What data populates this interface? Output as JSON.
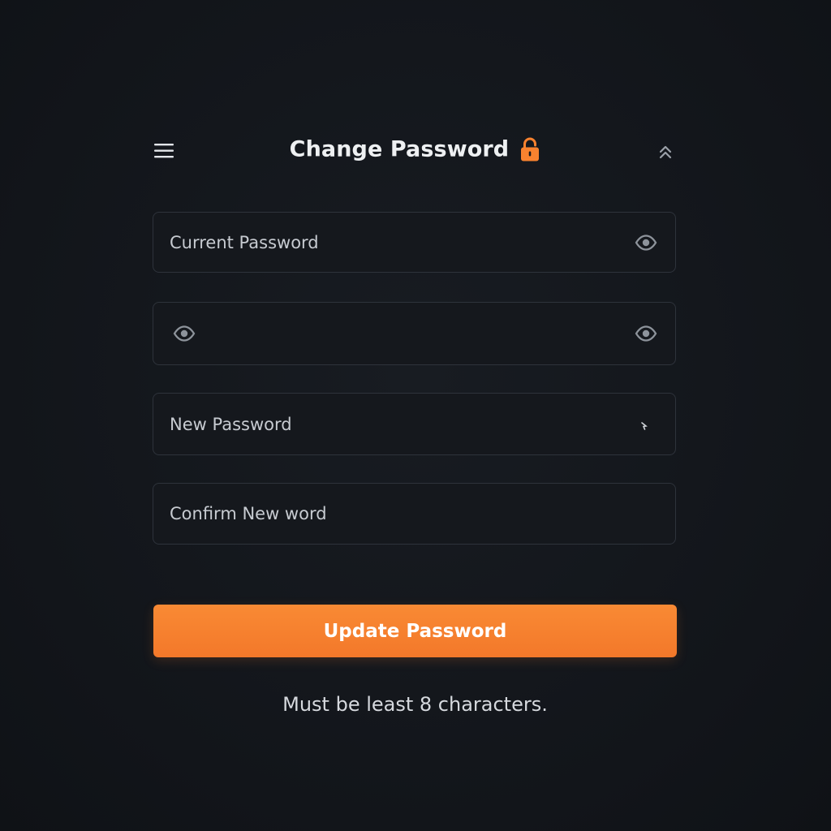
{
  "header": {
    "title": "Change Password",
    "menu_icon": "hamburger-menu-icon",
    "lock_icon": "lock-icon",
    "collapse_icon": "chevron-up-icon",
    "accent_color": "#f7822f"
  },
  "form": {
    "current_password": {
      "placeholder": "Current Password",
      "value": "",
      "toggle_icon": "eye-icon"
    },
    "unlabeled_password": {
      "placeholder": "",
      "value": "",
      "left_icon": "eye-icon",
      "toggle_icon": "eye-icon"
    },
    "new_password": {
      "placeholder": "New Password",
      "value": ""
    },
    "confirm_password": {
      "placeholder": "Confirm New word",
      "value": ""
    }
  },
  "actions": {
    "update_label": "Update Password",
    "update_color": "#f7822f"
  },
  "hint": {
    "text": "Must be least 8 characters."
  }
}
